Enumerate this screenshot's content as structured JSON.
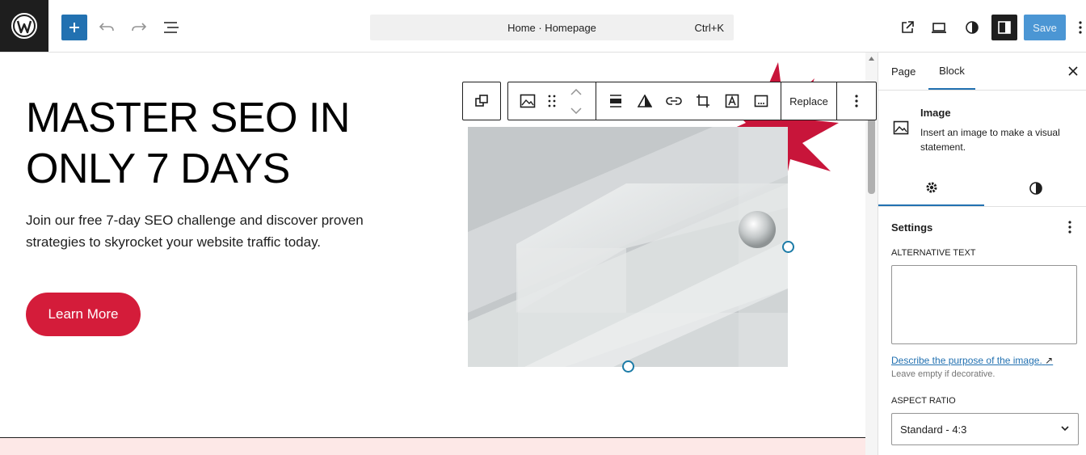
{
  "topbar": {
    "document_title": "Home · Homepage",
    "shortcut": "Ctrl+K",
    "save_label": "Save",
    "icons": [
      "wordpress-logo",
      "plus-icon",
      "undo-icon",
      "redo-icon",
      "list-view-icon",
      "external-link-icon",
      "laptop-icon",
      "styles-icon",
      "sidebar-icon",
      "more-vertical-icon"
    ]
  },
  "canvas": {
    "heading": "MASTER SEO IN ONLY 7 DAYS",
    "paragraph": "Join our free 7-day SEO challenge and discover proven strategies to skyrocket your website traffic today.",
    "button_label": "Learn More"
  },
  "block_toolbar": {
    "replace_label": "Replace"
  },
  "sidebar": {
    "tabs": [
      "Page",
      "Block"
    ],
    "active_tab": "Block",
    "block_title": "Image",
    "block_description": "Insert an image to make a visual statement.",
    "settings_title": "Settings",
    "alt_text_label": "ALTERNATIVE TEXT",
    "alt_text_value": "",
    "alt_link": "Describe the purpose of the image.",
    "alt_help": "Leave empty if decorative.",
    "aspect_label": "ASPECT RATIO",
    "aspect_value": "Standard - 4:3"
  },
  "colors": {
    "accent": "#2271b1",
    "cta": "#d41c3a",
    "save": "#4b96d4",
    "handle": "#1b7ba7"
  }
}
